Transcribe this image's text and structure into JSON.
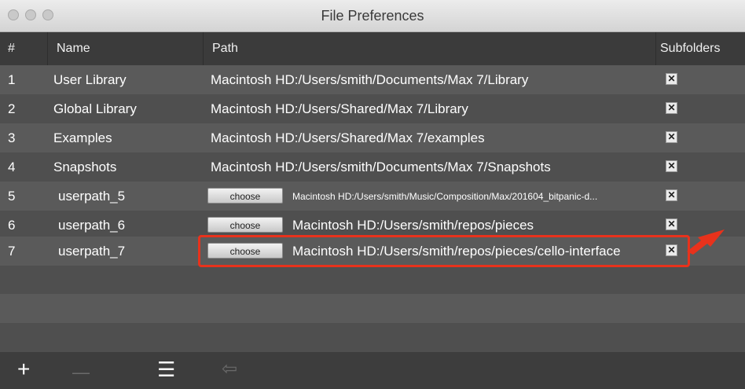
{
  "window": {
    "title": "File Preferences"
  },
  "columns": {
    "num": "#",
    "name": "Name",
    "path": "Path",
    "subfolders": "Subfolders"
  },
  "rows": [
    {
      "num": "1",
      "name": "User Library",
      "path": "Macintosh HD:/Users/smith/Documents/Max 7/Library",
      "choose": false,
      "subfolders": true
    },
    {
      "num": "2",
      "name": "Global Library",
      "path": "Macintosh HD:/Users/Shared/Max 7/Library",
      "choose": false,
      "subfolders": true
    },
    {
      "num": "3",
      "name": "Examples",
      "path": "Macintosh HD:/Users/Shared/Max 7/examples",
      "choose": false,
      "subfolders": true
    },
    {
      "num": "4",
      "name": "Snapshots",
      "path": "Macintosh HD:/Users/smith/Documents/Max 7/Snapshots",
      "choose": false,
      "subfolders": true
    },
    {
      "num": "5",
      "name": "userpath_5",
      "path": "Macintosh HD:/Users/smith/Music/Composition/Max/201604_bitpanic-d...",
      "choose": true,
      "choose_label": "choose",
      "subfolders": true
    },
    {
      "num": "6",
      "name": "userpath_6",
      "path": "Macintosh HD:/Users/smith/repos/pieces",
      "choose": true,
      "choose_label": "choose",
      "subfolders": true
    },
    {
      "num": "7",
      "name": "userpath_7",
      "path": "Macintosh HD:/Users/smith/repos/pieces/cello-interface",
      "choose": true,
      "choose_label": "choose",
      "subfolders": true
    }
  ],
  "checkbox_mark": "✕",
  "toolbar": {
    "add": "+",
    "remove": "—",
    "menu": "☰",
    "back": "⇦"
  },
  "colors": {
    "highlight": "#e8321c",
    "background": "#505050"
  }
}
